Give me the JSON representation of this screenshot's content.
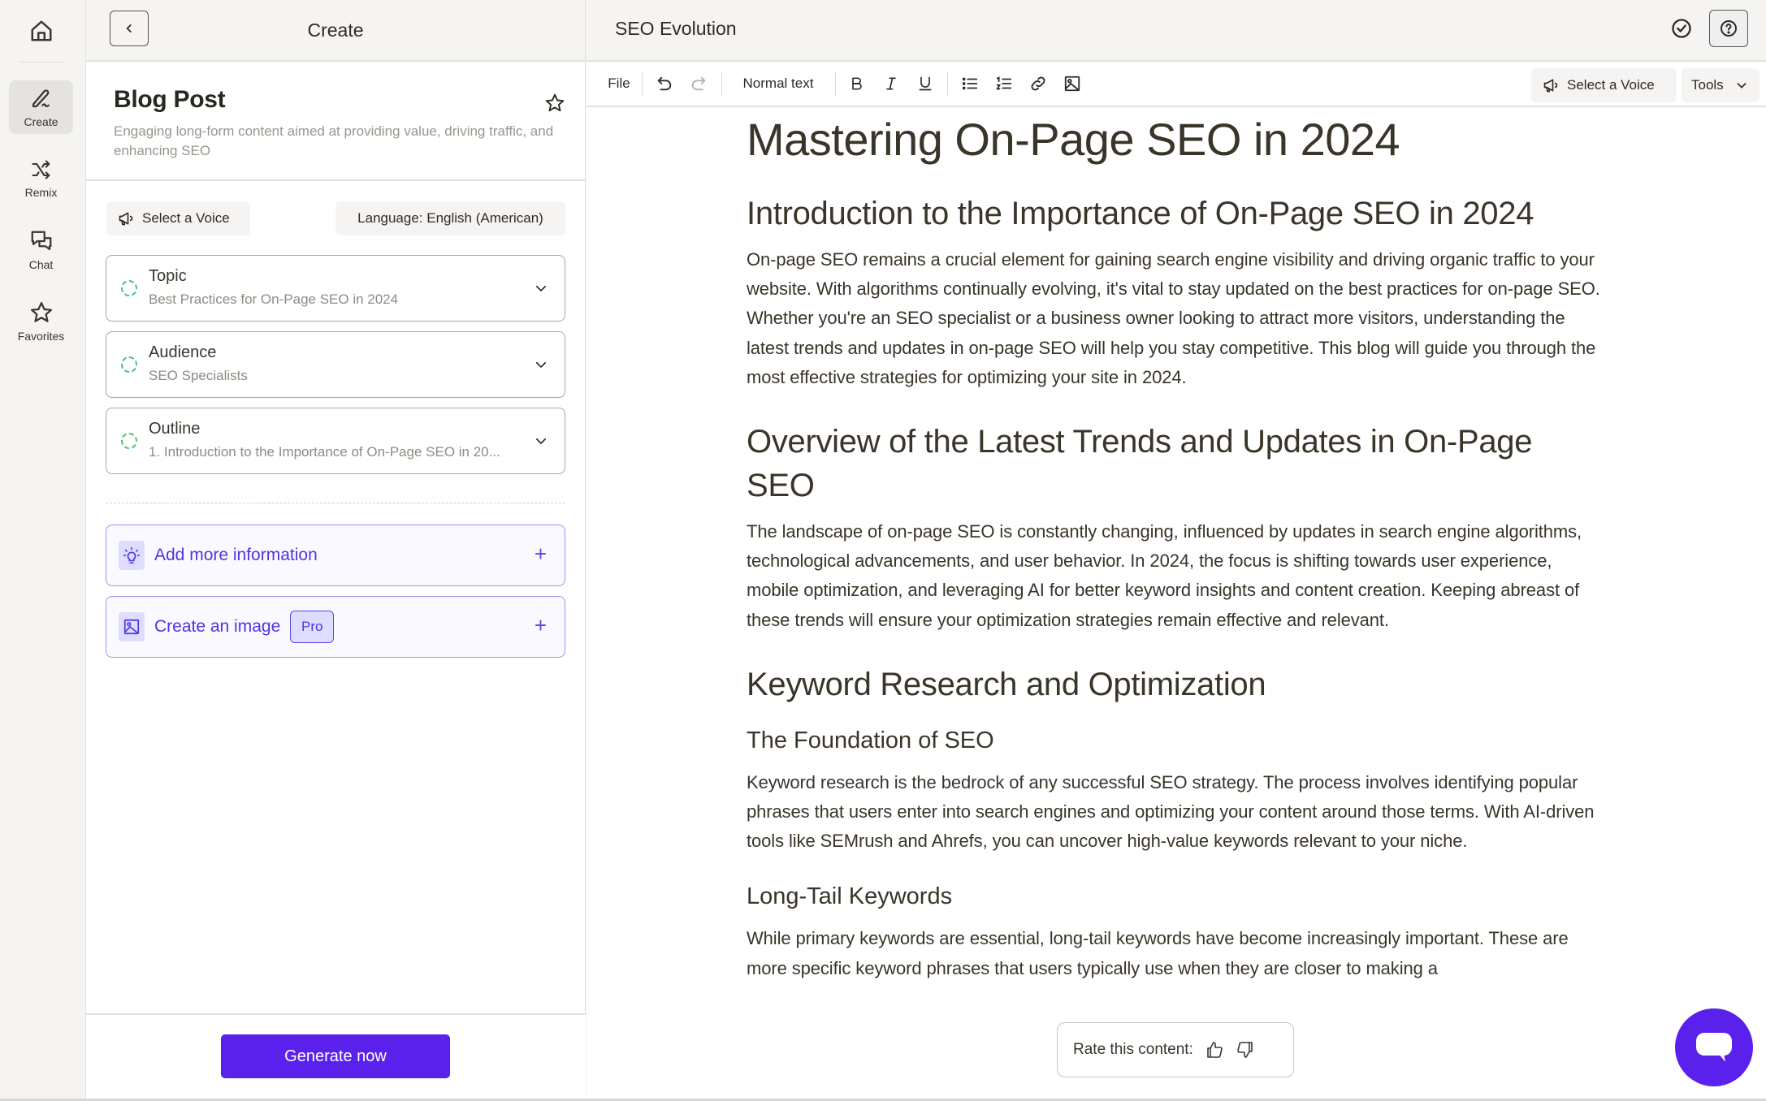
{
  "rail": {
    "home_icon": "home-icon",
    "items": [
      {
        "label": "Create",
        "icon": "pen-icon",
        "active": true
      },
      {
        "label": "Remix",
        "icon": "shuffle-icon",
        "active": false
      },
      {
        "label": "Chat",
        "icon": "chat-bubbles-icon",
        "active": false
      },
      {
        "label": "Favorites",
        "icon": "star-icon",
        "active": false
      }
    ]
  },
  "create_panel": {
    "title": "Create",
    "back_icon": "chevron-left-icon",
    "template": {
      "name": "Blog Post",
      "description": "Engaging long-form content aimed at providing value, driving traffic, and enhancing SEO",
      "favorite_icon": "star-outline-icon"
    },
    "voice_button": "Select a Voice",
    "language_button": "Language: English (American)",
    "fields": [
      {
        "label": "Topic",
        "value": "Best Practices for On-Page SEO in 2024"
      },
      {
        "label": "Audience",
        "value": "SEO Specialists"
      },
      {
        "label": "Outline",
        "value": "1. Introduction to the Importance of On-Page SEO in 20..."
      }
    ],
    "actions": [
      {
        "label": "Add more information",
        "icon": "lightbulb-icon",
        "badge": null
      },
      {
        "label": "Create an image",
        "icon": "image-icon",
        "badge": "Pro"
      }
    ],
    "generate_button": "Generate now"
  },
  "editor": {
    "doc_title": "SEO Evolution",
    "toolbar": {
      "file": "File",
      "text_style": "Normal text",
      "voice_button": "Select a Voice",
      "tools_button": "Tools"
    },
    "content": {
      "h1": "Mastering On-Page SEO in 2024",
      "sections": [
        {
          "h2": "Introduction to the Importance of On-Page SEO in 2024",
          "p": "On-page SEO remains a crucial element for gaining search engine visibility and driving organic traffic to your website. With algorithms continually evolving, it's vital to stay updated on the best practices for on-page SEO. Whether you're an SEO specialist or a business owner looking to attract more visitors, understanding the latest trends and updates in on-page SEO will help you stay competitive. This blog will guide you through the most effective strategies for optimizing your site in 2024."
        },
        {
          "h2": "Overview of the Latest Trends and Updates in On-Page SEO",
          "p": "The landscape of on-page SEO is constantly changing, influenced by updates in search engine algorithms, technological advancements, and user behavior. In 2024, the focus is shifting towards user experience, mobile optimization, and leveraging AI for better keyword insights and content creation. Keeping abreast of these trends will ensure your optimization strategies remain effective and relevant."
        },
        {
          "h2": "Keyword Research and Optimization",
          "h3": "The Foundation of SEO",
          "p": "Keyword research is the bedrock of any successful SEO strategy. The process involves identifying popular phrases that users enter into search engines and optimizing your content around those terms. With AI-driven tools like SEMrush and Ahrefs, you can uncover high-value keywords relevant to your niche."
        },
        {
          "h3": "Long-Tail Keywords",
          "p": "While primary keywords are essential, long-tail keywords have become increasingly important. These are more specific keyword phrases that users typically use when they are closer to making a"
        }
      ]
    },
    "rate_popup": {
      "label": "Rate this content:"
    }
  },
  "colors": {
    "accent": "#5b21ec",
    "accent_text": "#4c36e0",
    "status_dot": "#4cc27a",
    "panel_bg": "#f5f4f2"
  }
}
